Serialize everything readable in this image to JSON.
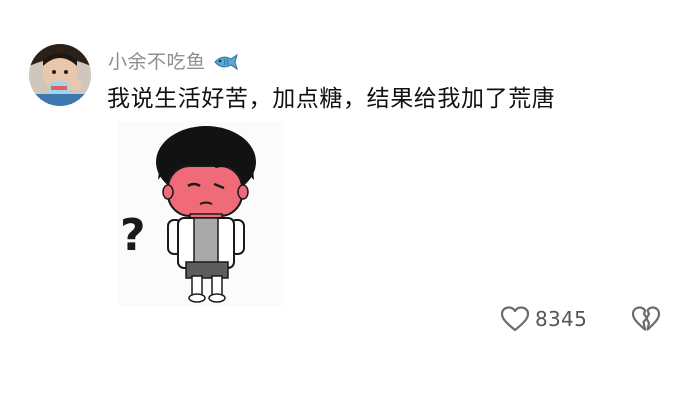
{
  "comment": {
    "username": "小余不吃鱼",
    "username_badge_icon": "fish-icon",
    "text": "我说生活好苦，加点糖，结果给我加了荒唐",
    "sticker": {
      "description_icon": "confused-cartoon-kid-sticker",
      "mark": "?"
    },
    "actions": {
      "like_icon": "heart-icon",
      "like_count": "8345",
      "dislike_icon": "broken-heart-icon"
    }
  },
  "colors": {
    "username": "#8f8f8f",
    "text": "#111111",
    "icon_stroke": "#6b6b6b",
    "sticker_face": "#f06b78",
    "sticker_hair": "#111111"
  }
}
